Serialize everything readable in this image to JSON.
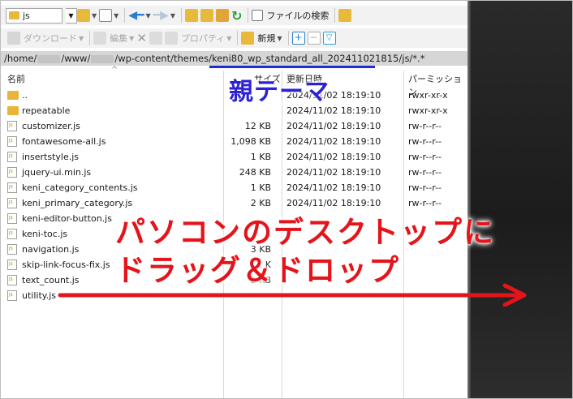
{
  "toolbar1": {
    "drive_label": "js",
    "search_label": "ファイルの検索"
  },
  "toolbar2": {
    "download_label": "ダウンロード",
    "edit_label": "編集",
    "properties_label": "プロパティ",
    "new_label": "新規"
  },
  "path": {
    "prefix": "/home/",
    "mid": "/www/",
    "rest": "/wp-content/themes/keni80_wp_standard_all_202411021815/js/*.*"
  },
  "columns": {
    "name": "名前",
    "size": "サイズ",
    "modified": "更新日時",
    "permission": "パーミッション"
  },
  "files": [
    {
      "name": "..",
      "size": "",
      "date": "2024/11/02 18:19:10",
      "perm": "rwxr-xr-x",
      "icon": "folder-up-icon"
    },
    {
      "name": "repeatable",
      "size": "",
      "date": "2024/11/02 18:19:10",
      "perm": "rwxr-xr-x",
      "icon": "folder-icon"
    },
    {
      "name": "customizer.js",
      "size": "12 KB",
      "date": "2024/11/02 18:19:10",
      "perm": "rw-r--r--",
      "icon": "js-file-icon"
    },
    {
      "name": "fontawesome-all.js",
      "size": "1,098 KB",
      "date": "2024/11/02 18:19:10",
      "perm": "rw-r--r--",
      "icon": "js-file-icon"
    },
    {
      "name": "insertstyle.js",
      "size": "1 KB",
      "date": "2024/11/02 18:19:10",
      "perm": "rw-r--r--",
      "icon": "js-file-icon"
    },
    {
      "name": "jquery-ui.min.js",
      "size": "248 KB",
      "date": "2024/11/02 18:19:10",
      "perm": "rw-r--r--",
      "icon": "js-file-icon"
    },
    {
      "name": "keni_category_contents.js",
      "size": "1 KB",
      "date": "2024/11/02 18:19:10",
      "perm": "rw-r--r--",
      "icon": "js-file-icon"
    },
    {
      "name": "keni_primary_category.js",
      "size": "2 KB",
      "date": "2024/11/02 18:19:10",
      "perm": "rw-r--r--",
      "icon": "js-file-icon"
    },
    {
      "name": "keni-editor-button.js",
      "size": "",
      "date": "",
      "perm": "",
      "icon": "js-file-icon"
    },
    {
      "name": "keni-toc.js",
      "size": "3",
      "date": "",
      "perm": "",
      "icon": "js-file-icon"
    },
    {
      "name": "navigation.js",
      "size": "3 KB",
      "date": "",
      "perm": "",
      "icon": "js-file-icon"
    },
    {
      "name": "skip-link-focus-fix.js",
      "size": "1 K",
      "date": "",
      "perm": "",
      "icon": "js-file-icon"
    },
    {
      "name": "text_count.js",
      "size": "2 KB",
      "date": "",
      "perm": "",
      "icon": "js-file-icon"
    },
    {
      "name": "utility.js",
      "size": "",
      "date": "",
      "perm": "",
      "icon": "js-file-icon"
    }
  ],
  "annotations": {
    "title": "親テーマ",
    "line1": "パソコンのデスクトップに",
    "line2": "ドラッグ＆ドロップ"
  },
  "colors": {
    "annotation_blue": "#2c21d6",
    "annotation_red": "#e5141b",
    "path_bar": "#d6d6d6",
    "desktop": "#1f1f1f"
  }
}
